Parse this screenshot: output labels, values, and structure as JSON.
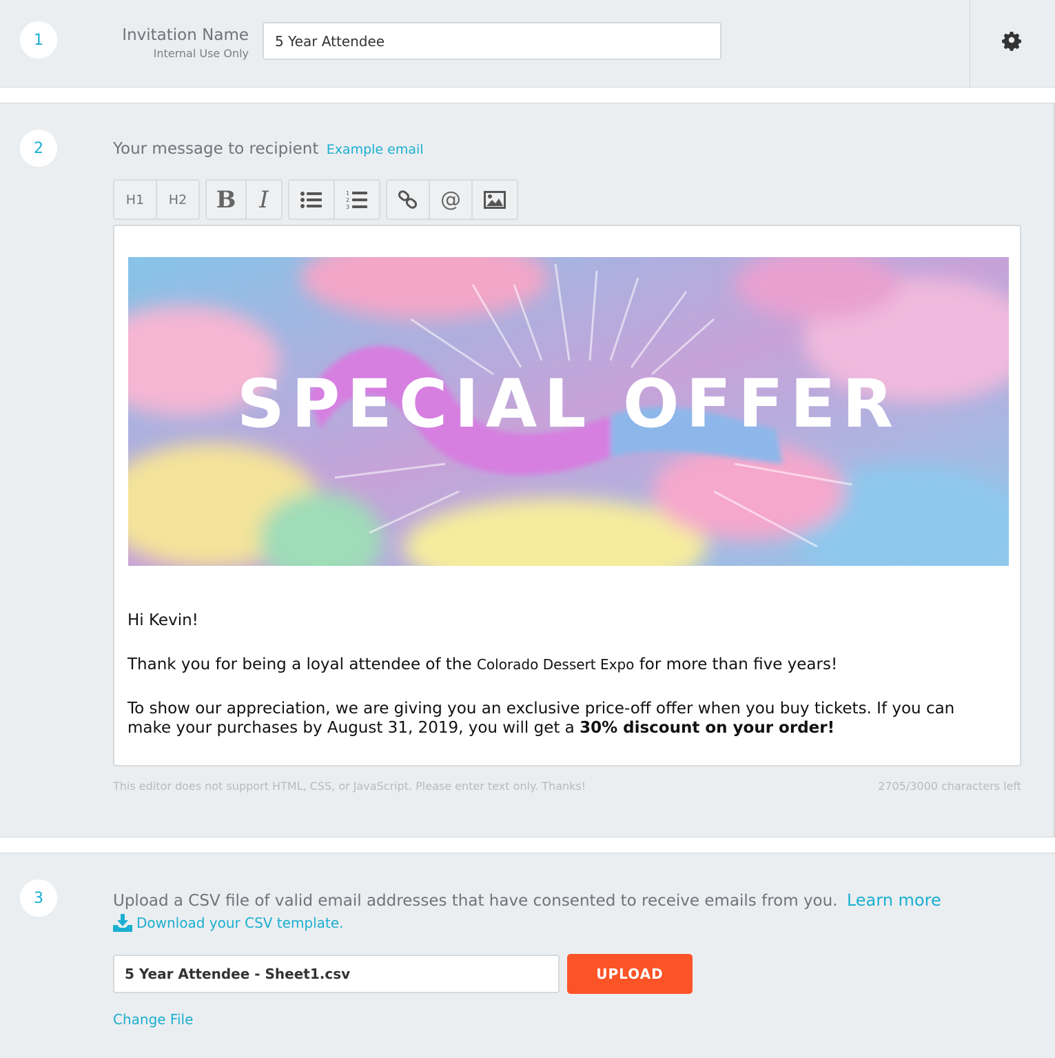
{
  "step1": {
    "number": "1",
    "label": "Invitation Name",
    "sublabel": "Internal Use Only",
    "input_value": "5 Year Attendee"
  },
  "step2": {
    "number": "2",
    "title": "Your message to recipient",
    "example_link": "Example email",
    "toolbar": {
      "h1": "H1",
      "h2": "H2",
      "bold": "B",
      "italic": "I",
      "mention": "@"
    },
    "banner_text": "SPECIAL OFFER",
    "email": {
      "greeting": "Hi Kevin!",
      "p1_before": "Thank you for being a loyal attendee of the ",
      "p1_event": "Colorado Dessert Expo",
      "p1_after": " for more than five years!",
      "p2_before": "To show our appreciation, we are giving you an exclusive price-off offer when you buy tickets. If you can make your purchases by August 31, 2019, you will get a ",
      "p2_bold": "30% discount on your order!"
    },
    "note": "This editor does not support HTML, CSS, or JavaScript. Please enter text only. Thanks!",
    "char_count": "2705/3000 characters left"
  },
  "step3": {
    "number": "3",
    "title": "Upload a CSV file of valid email addresses that have consented to receive emails from you.",
    "learn_more": "Learn more",
    "download_link": "Download your CSV template.",
    "file_value": "5 Year Attendee - Sheet1.csv",
    "upload_label": "UPLOAD",
    "change_file": "Change File"
  },
  "colors": {
    "accent": "#1aafd0",
    "upload": "#fc5427",
    "background": "#ebeef1"
  },
  "icons": [
    "gear-icon",
    "bulleted-list-icon",
    "numbered-list-icon",
    "link-icon",
    "image-icon",
    "download-icon"
  ]
}
